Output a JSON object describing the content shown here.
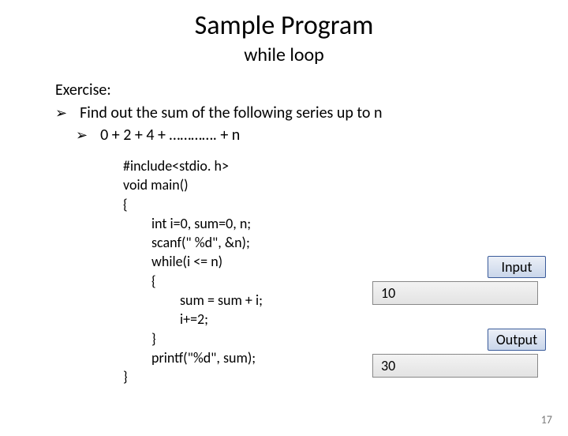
{
  "title": "Sample Program",
  "subtitle": "while loop",
  "exercise_label": "Exercise:",
  "bullets": {
    "b1": "Find out the sum of  the following series up to n",
    "b2": "0 + 2 + 4 + …………. + n"
  },
  "code": {
    "l1": "#include<stdio. h>",
    "l2": "void main()",
    "l3": "{",
    "l4": "int  i=0, sum=0, n;",
    "l5": "scanf(\" %d\", &n);",
    "l6": "while(i <= n)",
    "l7": "{",
    "l8": "sum = sum + i;",
    "l9": "i+=2;",
    "l10": "}",
    "l11": "printf(\"%d\", sum);",
    "l12": "}"
  },
  "io": {
    "input_label": "Input",
    "output_label": "Output",
    "input_value": "10",
    "output_value": "30"
  },
  "page_number": "17"
}
